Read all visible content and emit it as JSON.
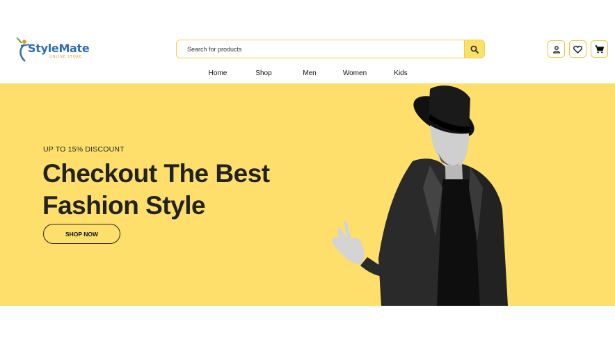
{
  "brand": {
    "name": "StyleMate",
    "tagline": "ONLINE STORE"
  },
  "search": {
    "placeholder": "Search for products",
    "button_icon": "search-icon"
  },
  "header_icons": [
    "user-icon",
    "heart-icon",
    "cart-icon"
  ],
  "nav": {
    "items": [
      {
        "label": "Home"
      },
      {
        "label": "Shop"
      },
      {
        "label": "Men"
      },
      {
        "label": "Women"
      },
      {
        "label": "Kids"
      }
    ]
  },
  "hero": {
    "eyebrow": "UP TO 15% DISCOUNT",
    "headline_line1": "Checkout The Best",
    "headline_line2": "Fashion Style",
    "cta_label": "SHOP NOW"
  },
  "colors": {
    "accent": "#fedf6c",
    "border_accent": "#e7c43b",
    "brand_blue": "#2d6cb5",
    "brand_orange": "#e09a2c",
    "text_dark": "#222222"
  }
}
